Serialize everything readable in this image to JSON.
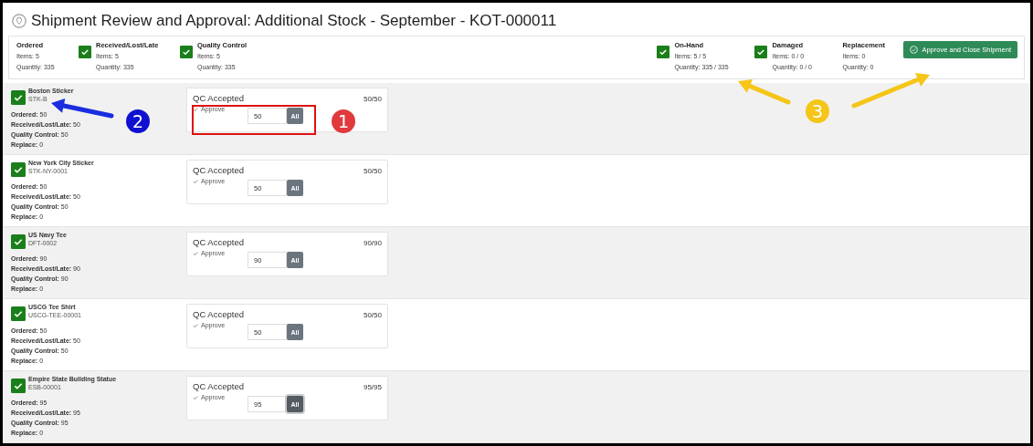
{
  "title": "Shipment Review and Approval: Additional Stock - September - KOT-000011",
  "summary": [
    {
      "label": "Ordered",
      "items": "Items: 5",
      "quantity": "Quantity: 335"
    },
    {
      "label": "Received/Lost/Late",
      "checked": true,
      "items": "Items: 5",
      "quantity": "Quantity: 335"
    },
    {
      "label": "Quality Control",
      "checked": true,
      "items": "Items: 5",
      "quantity": "Quantity: 335"
    }
  ],
  "summary_right": [
    {
      "label": "On-Hand",
      "checked": true,
      "items": "Items: 5 / 5",
      "quantity": "Quantity: 335 / 335"
    },
    {
      "label": "Damaged",
      "checked": true,
      "items": "Items: 0 / 0",
      "quantity": "Quantity: 0 / 0"
    },
    {
      "label": "Replacement",
      "items": "Items: 0",
      "quantity": "Quantity: 0"
    }
  ],
  "approve_button": "Approve and Close Shipment",
  "rows": [
    {
      "name": "Boston Sticker",
      "sku": "STK-B",
      "checked": true,
      "details": [
        {
          "label": "Ordered:",
          "value": "50"
        },
        {
          "label": "Received/Lost/Late:",
          "value": "50"
        },
        {
          "label": "Quality Control:",
          "value": "50"
        },
        {
          "label": "Replace:",
          "value": "0"
        }
      ],
      "card_title": "QC Accepted",
      "count": "50/50",
      "approve": "Approve",
      "value": "50",
      "all": "All",
      "focused": false
    },
    {
      "name": "New York City Sticker",
      "sku": "STK-NY-0001",
      "checked": true,
      "details": [
        {
          "label": "Ordered:",
          "value": "50"
        },
        {
          "label": "Received/Lost/Late:",
          "value": "50"
        },
        {
          "label": "Quality Control:",
          "value": "50"
        },
        {
          "label": "Replace:",
          "value": "0"
        }
      ],
      "card_title": "QC Accepted",
      "count": "50/50",
      "approve": "Approve",
      "value": "50",
      "all": "All",
      "focused": false
    },
    {
      "name": "US Navy Tee",
      "sku": "DFT-0002",
      "checked": true,
      "details": [
        {
          "label": "Ordered:",
          "value": "90"
        },
        {
          "label": "Received/Lost/Late:",
          "value": "90"
        },
        {
          "label": "Quality Control:",
          "value": "90"
        },
        {
          "label": "Replace:",
          "value": "0"
        }
      ],
      "card_title": "QC Accepted",
      "count": "90/90",
      "approve": "Approve",
      "value": "90",
      "all": "All",
      "focused": false
    },
    {
      "name": "USCG Tee Shirt",
      "sku": "USCG-TEE-00001",
      "checked": true,
      "details": [
        {
          "label": "Ordered:",
          "value": "50"
        },
        {
          "label": "Received/Lost/Late:",
          "value": "50"
        },
        {
          "label": "Quality Control:",
          "value": "50"
        },
        {
          "label": "Replace:",
          "value": "0"
        }
      ],
      "card_title": "QC Accepted",
      "count": "50/50",
      "approve": "Approve",
      "value": "50",
      "all": "All",
      "focused": false
    },
    {
      "name": "Empire State Building Statue",
      "sku": "ESB-00001",
      "checked": true,
      "details": [
        {
          "label": "Ordered:",
          "value": "95"
        },
        {
          "label": "Received/Lost/Late:",
          "value": "95"
        },
        {
          "label": "Quality Control:",
          "value": "95"
        },
        {
          "label": "Replace:",
          "value": "0"
        }
      ],
      "card_title": "QC Accepted",
      "count": "95/95",
      "approve": "Approve",
      "value": "95",
      "all": "All",
      "focused": true
    }
  ],
  "annotations": [
    {
      "kind": "badge",
      "label": "1",
      "color": "#e0393e"
    },
    {
      "kind": "badge",
      "label": "2",
      "color": "#1010d0"
    },
    {
      "kind": "badge",
      "label": "3",
      "color": "#f5c518"
    },
    {
      "kind": "frame",
      "color": "#e01010"
    },
    {
      "kind": "arrow",
      "color": "#1a2ee0"
    },
    {
      "kind": "arrow",
      "color": "#f5c518"
    },
    {
      "kind": "arrow",
      "color": "#f5c518"
    }
  ]
}
